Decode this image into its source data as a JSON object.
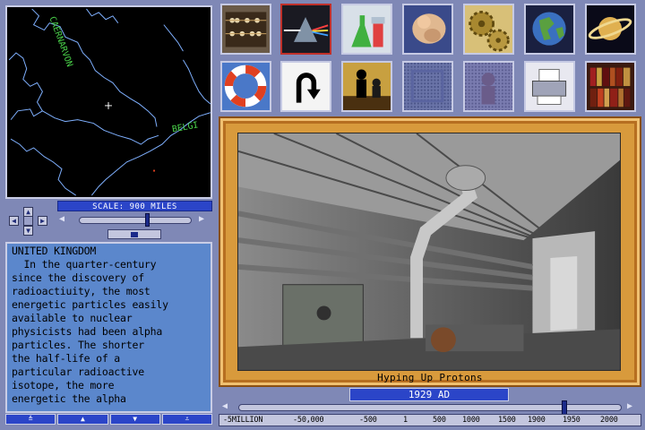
{
  "map": {
    "labels": [
      "CAERNARVON",
      "BELGI"
    ],
    "scale": "SCALE: 900 MILES"
  },
  "nav": {
    "up": "▲",
    "down": "▼",
    "left": "◀",
    "right": "▶",
    "slider_left": "◀",
    "slider_right": "▶"
  },
  "article": {
    "title": "UNITED KINGDOM",
    "body": "  In the quarter-century\nsince the discovery of\nradioactiuity, the most\nenergetic particles easily\navailable to nuclear\nphysicists had been alpha\nparticles. The shorter\nthe half-life of a\nparticular radioactive\nisotope, the more\nenergetic the alpha"
  },
  "scroll": {
    "buttons": [
      "≙",
      "▲",
      "▼",
      "⩡"
    ]
  },
  "icons": [
    {
      "name": "abacus-icon"
    },
    {
      "name": "prism-icon",
      "selected": true
    },
    {
      "name": "lab-flasks-icon"
    },
    {
      "name": "fetus-icon"
    },
    {
      "name": "gears-icon"
    },
    {
      "name": "globe-icon"
    },
    {
      "name": "saturn-icon"
    },
    {
      "name": "life-ring-icon"
    },
    {
      "name": "u-turn-back-icon"
    },
    {
      "name": "chess-pieces-icon"
    },
    {
      "name": "grid-pattern-icon"
    },
    {
      "name": "pattern-figure-icon"
    },
    {
      "name": "printer-icon"
    },
    {
      "name": "bookshelf-icon"
    }
  ],
  "photo": {
    "caption": "Hyping Up Protons",
    "subject": "particle accelerator tunnel"
  },
  "timeline": {
    "year": "1929 AD",
    "position": 0.85,
    "ticks": [
      "-5MILLION",
      "-50,000",
      "-500",
      "1",
      "500",
      "1000",
      "1500",
      "1900",
      "1950",
      "2000"
    ]
  },
  "colors": {
    "background": "#7f88b6",
    "panel_blue": "#2b45c8",
    "text_panel": "#5b87cc",
    "frame_gold": "#d89a3c",
    "selected_border": "#c0302a"
  }
}
